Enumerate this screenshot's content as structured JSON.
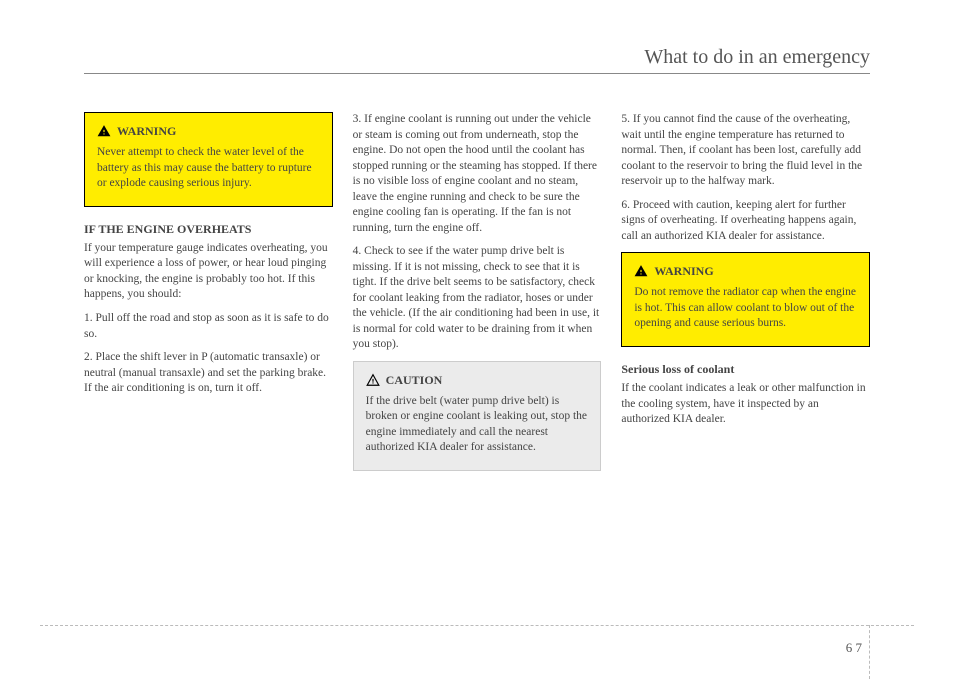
{
  "header": {
    "title": "What to do in an emergency"
  },
  "col1": {
    "warning": {
      "label": "WARNING",
      "body": "Never attempt to check the water level of the battery as this may cause the battery to rupture or explode causing serious injury."
    },
    "section_head": "IF THE ENGINE OVERHEATS",
    "para1": "If your temperature gauge indicates overheating, you will experience a loss of power, or hear loud pinging or knocking, the engine is probably too hot. If this happens, you should:",
    "item1": "1. Pull off the road and stop as soon as it is safe to do so.",
    "item2": "2. Place the shift lever in P (automatic transaxle) or neutral (manual transaxle) and set the parking brake. If the air conditioning is on, turn it off."
  },
  "col2": {
    "item3": "3. If engine coolant is running out under the vehicle or steam is coming out from underneath, stop the engine. Do not open the hood until the coolant has stopped running or the steaming has stopped. If there is no visible loss of engine coolant and no steam, leave the engine running and check to be sure the engine cooling fan is operating. If the fan is not running, turn the engine off.",
    "item4": "4. Check to see if the water pump drive belt is missing. If it is not missing, check to see that it is tight. If the drive belt seems to be satisfactory, check for coolant leaking from the radiator, hoses or under the vehicle. (If the air conditioning had been in use, it is normal for cold water to be draining from it when you stop).",
    "caution": {
      "label": "CAUTION",
      "body": "If the drive belt (water pump drive belt) is broken or engine coolant is leaking out, stop the engine immediately and call the nearest authorized KIA dealer for assistance."
    }
  },
  "col3": {
    "item5": "5. If you cannot find the cause of the overheating, wait until the engine temperature has returned to normal. Then, if coolant has been lost, carefully add coolant to the reservoir to bring the fluid level in the reservoir up to the halfway mark.",
    "item6": "6. Proceed with caution, keeping alert for further signs of overheating. If overheating happens again, call an authorized KIA dealer for assistance.",
    "warning": {
      "label": "WARNING",
      "body": "Do not remove the radiator cap when the engine is hot. This can allow coolant to blow out of the opening and cause serious burns."
    },
    "sub_head": "Serious loss of coolant",
    "para": "If the coolant indicates a leak or other malfunction in the cooling system, have it inspected by an authorized KIA dealer."
  },
  "page_number": "6 7"
}
